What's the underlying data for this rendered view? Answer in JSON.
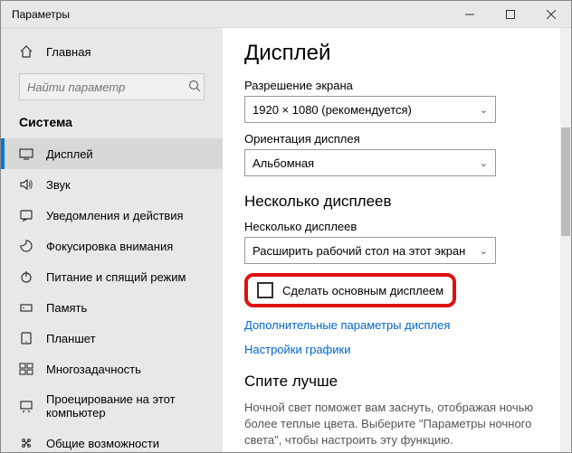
{
  "window": {
    "title": "Параметры"
  },
  "sidebar": {
    "home": "Главная",
    "search_placeholder": "Найти параметр",
    "heading": "Система",
    "items": [
      {
        "label": "Дисплей"
      },
      {
        "label": "Звук"
      },
      {
        "label": "Уведомления и действия"
      },
      {
        "label": "Фокусировка внимания"
      },
      {
        "label": "Питание и спящий режим"
      },
      {
        "label": "Память"
      },
      {
        "label": "Планшет"
      },
      {
        "label": "Многозадачность"
      },
      {
        "label": "Проецирование на этот компьютер"
      },
      {
        "label": "Общие возможности"
      }
    ]
  },
  "main": {
    "title": "Дисплей",
    "resolution_label": "Разрешение экрана",
    "resolution_value": "1920 × 1080 (рекомендуется)",
    "orientation_label": "Ориентация дисплея",
    "orientation_value": "Альбомная",
    "multi_heading": "Несколько дисплеев",
    "multi_label": "Несколько дисплеев",
    "multi_value": "Расширить рабочий стол на этот экран",
    "make_primary": "Сделать основным дисплеем",
    "advanced_link": "Дополнительные параметры дисплея",
    "graphics_link": "Настройки графики",
    "sleep_heading": "Спите лучше",
    "sleep_desc": "Ночной свет поможет вам заснуть, отображая ночью более теплые цвета. Выберите \"Параметры ночного света\", чтобы настроить эту функцию."
  }
}
